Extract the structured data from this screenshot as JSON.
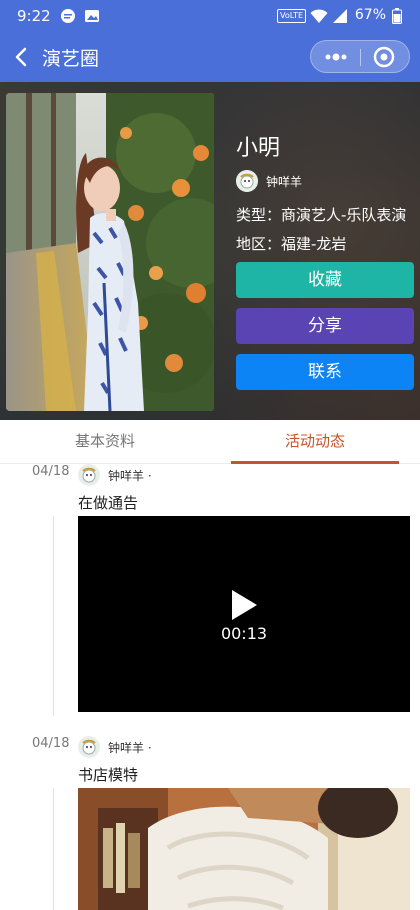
{
  "status_bar": {
    "time": "9:22",
    "volte": "VoLTE",
    "battery": "67%"
  },
  "nav": {
    "title": "演艺圈"
  },
  "profile": {
    "name": "小明",
    "author": "钟咩羊",
    "type_line": "类型：商演艺人-乐队表演",
    "region_line": "地区：福建-龙岩",
    "buttons": {
      "favorite": "收藏",
      "share": "分享",
      "contact": "联系"
    }
  },
  "tabs": {
    "basic": "基本资料",
    "activity": "活动动态",
    "active_tab": "activity"
  },
  "posts": [
    {
      "date": "04/18",
      "author": "钟咩羊 ·",
      "text": "在做通告",
      "media": "video",
      "duration": "00:13"
    },
    {
      "date": "04/18",
      "author": "钟咩羊 ·",
      "text": "书店模特",
      "media": "photo"
    }
  ],
  "colors": {
    "nav": "#4a6fd8",
    "favorite": "#1fb5a6",
    "share": "#5a43b3",
    "contact": "#0d84f6",
    "active_tab": "#c6532a"
  }
}
